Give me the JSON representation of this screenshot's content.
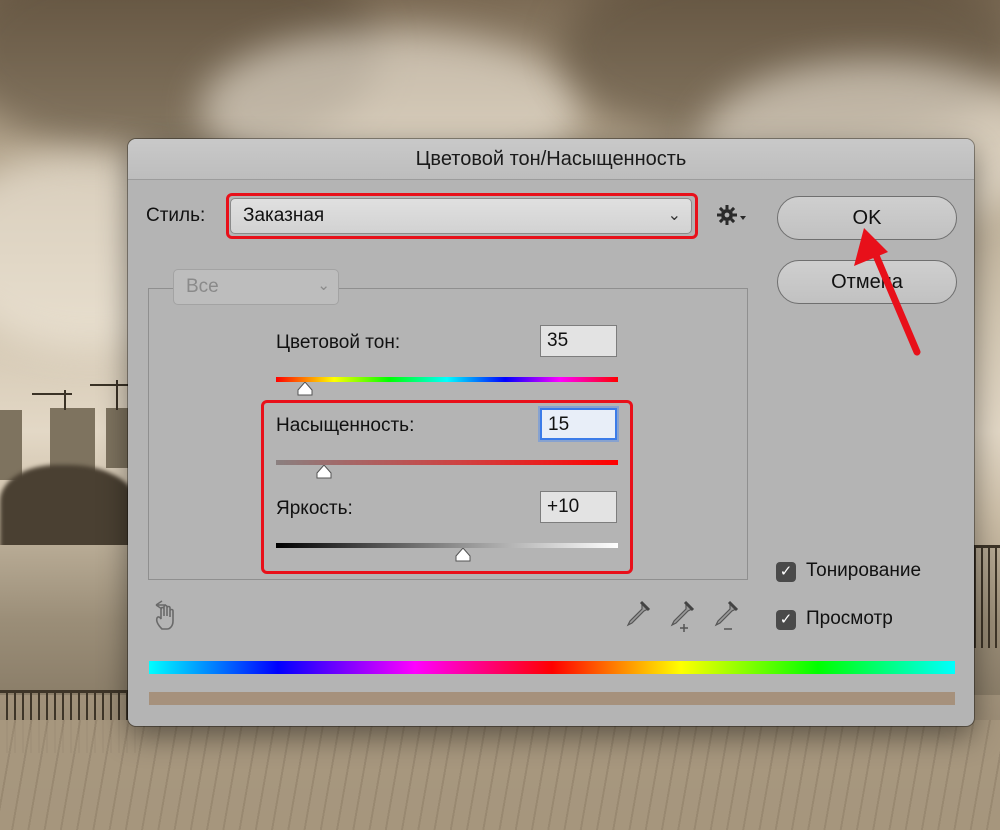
{
  "dialog": {
    "title": "Цветовой тон/Насыщенность",
    "style_label": "Стиль:",
    "style_value": "Заказная",
    "channel_value": "Все",
    "buttons": {
      "ok": "OK",
      "cancel": "Отмена"
    },
    "sliders": {
      "hue": {
        "label": "Цветовой тон:",
        "value": "35"
      },
      "saturation": {
        "label": "Насыщенность:",
        "value": "15"
      },
      "lightness": {
        "label": "Яркость:",
        "value": "+10"
      }
    },
    "checkboxes": {
      "colorize": {
        "label": "Тонирование",
        "checked": true
      },
      "preview": {
        "label": "Просмотр",
        "checked": true
      }
    }
  },
  "colors": {
    "highlight": "#e8101a",
    "colorize_bar": "#a6917c",
    "focus": "#3b7be8"
  },
  "icons": [
    "gear-icon",
    "targeted-adjustment-hand-icon",
    "eyedropper-icon",
    "eyedropper-add-icon",
    "eyedropper-subtract-icon",
    "checkmark-icon",
    "chevron-down-icon"
  ]
}
